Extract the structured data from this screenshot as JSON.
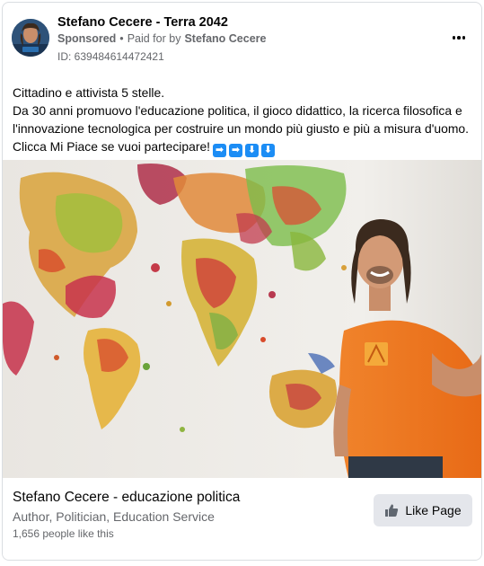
{
  "header": {
    "page_name": "Stefano Cecere - Terra 2042",
    "sponsored": "Sponsored",
    "separator": "•",
    "paid_for_by": "Paid for by",
    "payer": "Stefano Cecere",
    "ad_id": "ID: 639484614472421"
  },
  "post": {
    "lines": [
      "Cittadino e attivista 5 stelle.",
      "Da 30 anni promuovo l'educazione politica, il gioco didattico, la ricerca filosofica e",
      "l'innovazione tecnologica per costruire un mondo più giusto e più a misura d'uomo.",
      "Clicca Mi Piace se vuoi partecipare!"
    ],
    "emojis": [
      "➡",
      "➡",
      "⬇",
      "⬇"
    ]
  },
  "footer": {
    "title": "Stefano Cecere - educazione politica",
    "subtitle": "Author, Politician, Education Service",
    "likes": "1,656 people like this",
    "like_button": "Like Page"
  },
  "colors": {
    "accent_blue": "#1c8df5",
    "button_bg": "#e4e6eb",
    "secondary_text": "#65676b"
  },
  "icons": {
    "more": "more-horizontal-icon",
    "like": "thumbs-up-icon"
  }
}
